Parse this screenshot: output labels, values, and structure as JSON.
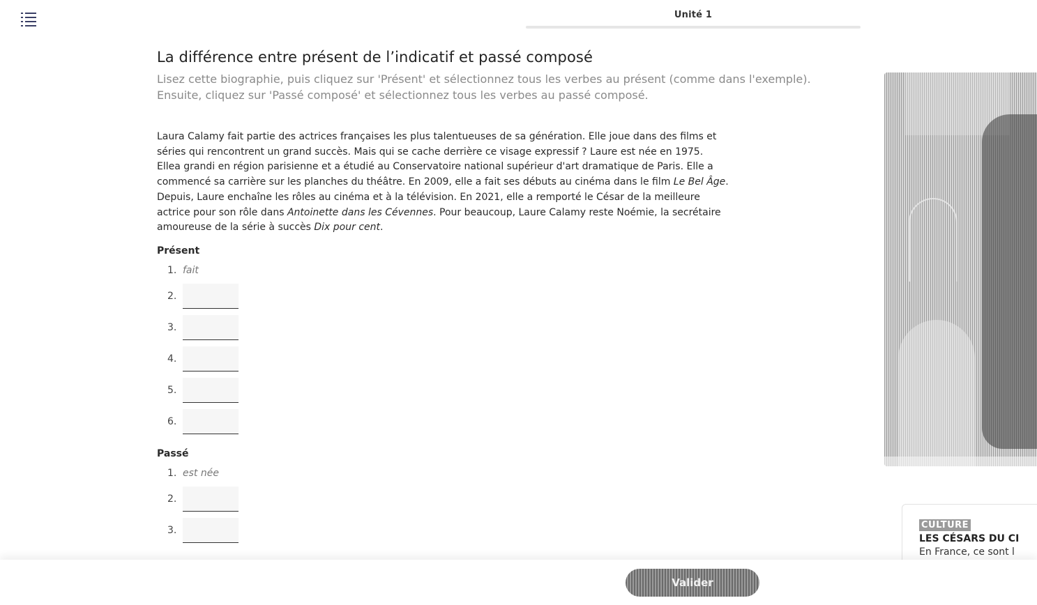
{
  "header": {
    "menu_icon": "list-menu-icon",
    "unit_title": "Unité 1"
  },
  "lesson": {
    "title": "La différence entre présent de l’indicatif et passé composé",
    "instructions": "Lisez cette biographie, puis cliquez sur 'Présent' et sélectionnez tous les verbes au présent (comme dans l'exemple). Ensuite, cliquez sur 'Passé composé' et sélectionnez tous les verbes au passé composé.",
    "bio": {
      "p1": "Laura Calamy fait partie des actrices françaises les plus talentueuses de sa génération. Elle joue dans des films et séries qui rencontrent un grand succès. Mais qui se cache derrière ce visage expressif ? Laure est née en 1975. Ellea grandi en région parisienne et a étudié au Conservatoire national supérieur d'art dramatique de Paris. Elle a commencé sa carrière sur les planches du théâtre. En 2009, elle a fait ses débuts au cinéma dans le film ",
      "film1": "Le Bel Âge",
      "p2": ". Depuis, Laure enchaîne les rôles au cinéma et à la télévision. En 2021, elle a remporté le César de la meilleure actrice pour son rôle dans ",
      "film2": "Antoinette dans les Cévennes",
      "p3": ". Pour beaucoup, Laure Calamy reste Noémie, la secrétaire amoureuse de la série à succès ",
      "series": "Dix pour cent",
      "p4": "."
    }
  },
  "present": {
    "label": "Présent",
    "example_number": "1.",
    "example": "fait",
    "numbers": [
      "2.",
      "3.",
      "4.",
      "5.",
      "6."
    ]
  },
  "passe": {
    "label": "Passé",
    "example_number": "1.",
    "example": "est née",
    "numbers": [
      "2.",
      "3."
    ]
  },
  "culture_card": {
    "tag": "CULTURE",
    "title": "LES CÉSARS DU CI",
    "text": "En France, ce sont l"
  },
  "footer": {
    "validate_label": "Valider"
  }
}
